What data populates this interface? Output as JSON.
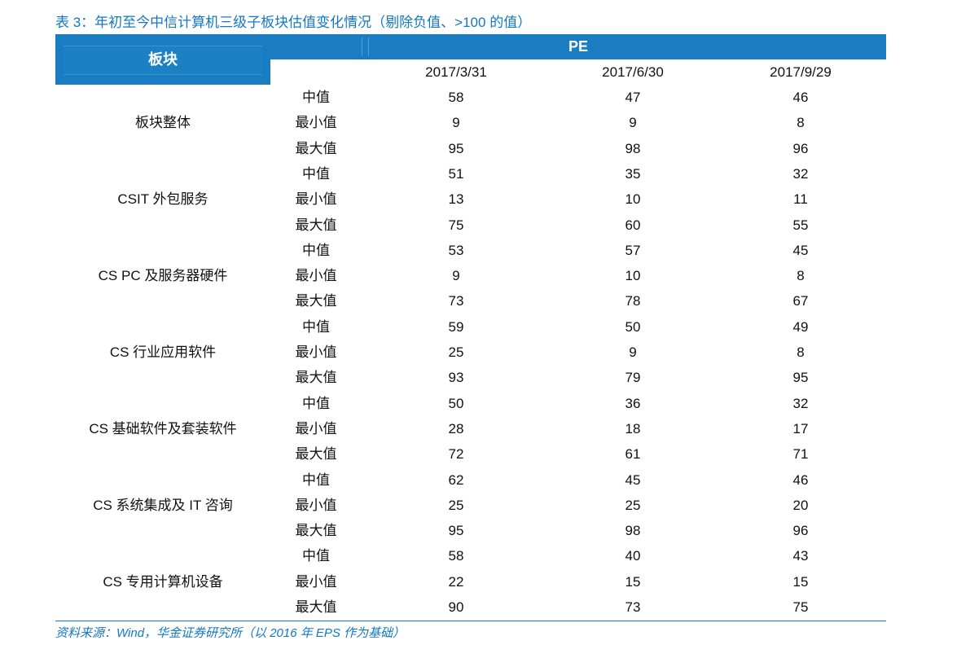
{
  "title": "表 3：年初至今中信计算机三级子板块估值变化情况（剔除负值、>100 的值）",
  "header": {
    "block_label": "板块",
    "pe_label": "PE",
    "dates": [
      "2017/3/31",
      "2017/6/30",
      "2017/9/29"
    ]
  },
  "stat_labels": [
    "中值",
    "最小值",
    "最大值"
  ],
  "sectors": [
    {
      "name": "板块整体",
      "rows": [
        [
          "58",
          "47",
          "46"
        ],
        [
          "9",
          "9",
          "8"
        ],
        [
          "95",
          "98",
          "96"
        ]
      ]
    },
    {
      "name": "CSIT 外包服务",
      "rows": [
        [
          "51",
          "35",
          "32"
        ],
        [
          "13",
          "10",
          "11"
        ],
        [
          "75",
          "60",
          "55"
        ]
      ]
    },
    {
      "name": "CS PC 及服务器硬件",
      "rows": [
        [
          "53",
          "57",
          "45"
        ],
        [
          "9",
          "10",
          "8"
        ],
        [
          "73",
          "78",
          "67"
        ]
      ]
    },
    {
      "name": "CS 行业应用软件",
      "rows": [
        [
          "59",
          "50",
          "49"
        ],
        [
          "25",
          "9",
          "8"
        ],
        [
          "93",
          "79",
          "95"
        ]
      ]
    },
    {
      "name": "CS 基础软件及套装软件",
      "rows": [
        [
          "50",
          "36",
          "32"
        ],
        [
          "28",
          "18",
          "17"
        ],
        [
          "72",
          "61",
          "71"
        ]
      ]
    },
    {
      "name": "CS 系统集成及 IT 咨询",
      "rows": [
        [
          "62",
          "45",
          "46"
        ],
        [
          "25",
          "25",
          "20"
        ],
        [
          "95",
          "98",
          "96"
        ]
      ]
    },
    {
      "name": "CS 专用计算机设备",
      "rows": [
        [
          "58",
          "40",
          "43"
        ],
        [
          "22",
          "15",
          "15"
        ],
        [
          "90",
          "73",
          "75"
        ]
      ]
    }
  ],
  "source": "资料来源：Wind，华金证券研究所（以 2016 年 EPS 作为基础）",
  "colors": {
    "accent": "#1a7dc2",
    "title_text": "#1477c4"
  }
}
